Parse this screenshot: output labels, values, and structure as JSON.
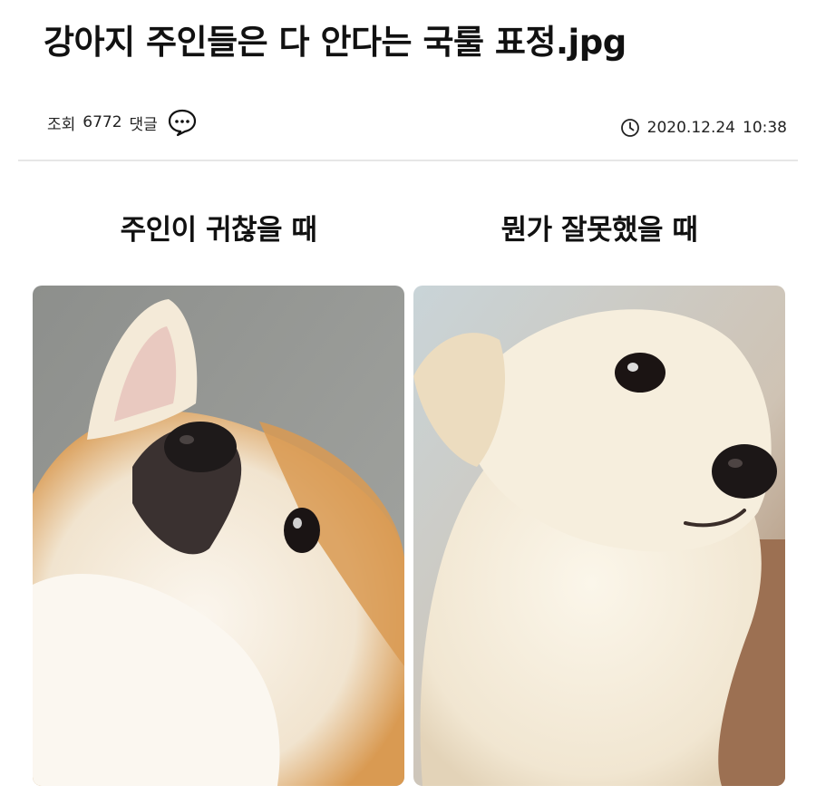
{
  "post": {
    "title": "강아지 주인들은 다 안다는 국룰 표정.jpg",
    "views_label": "조회",
    "views_count": "6772",
    "comments_label": "댓글",
    "comment_icon": "speech-bubble-icon",
    "clock_icon": "clock-icon",
    "date": "2020.12.24",
    "time": "10:38"
  },
  "panels": [
    {
      "caption": "주인이 귀찮을 때",
      "image": "shiba-puppy-looking-up-photo"
    },
    {
      "caption": "뭔가 잘못했을 때",
      "image": "white-puppy-side-glance-photo"
    }
  ],
  "colors": {
    "text": "#111111",
    "divider": "#e6e6e6",
    "shiba_fur": "#d99a52",
    "white_fur": "#f3ead8"
  }
}
